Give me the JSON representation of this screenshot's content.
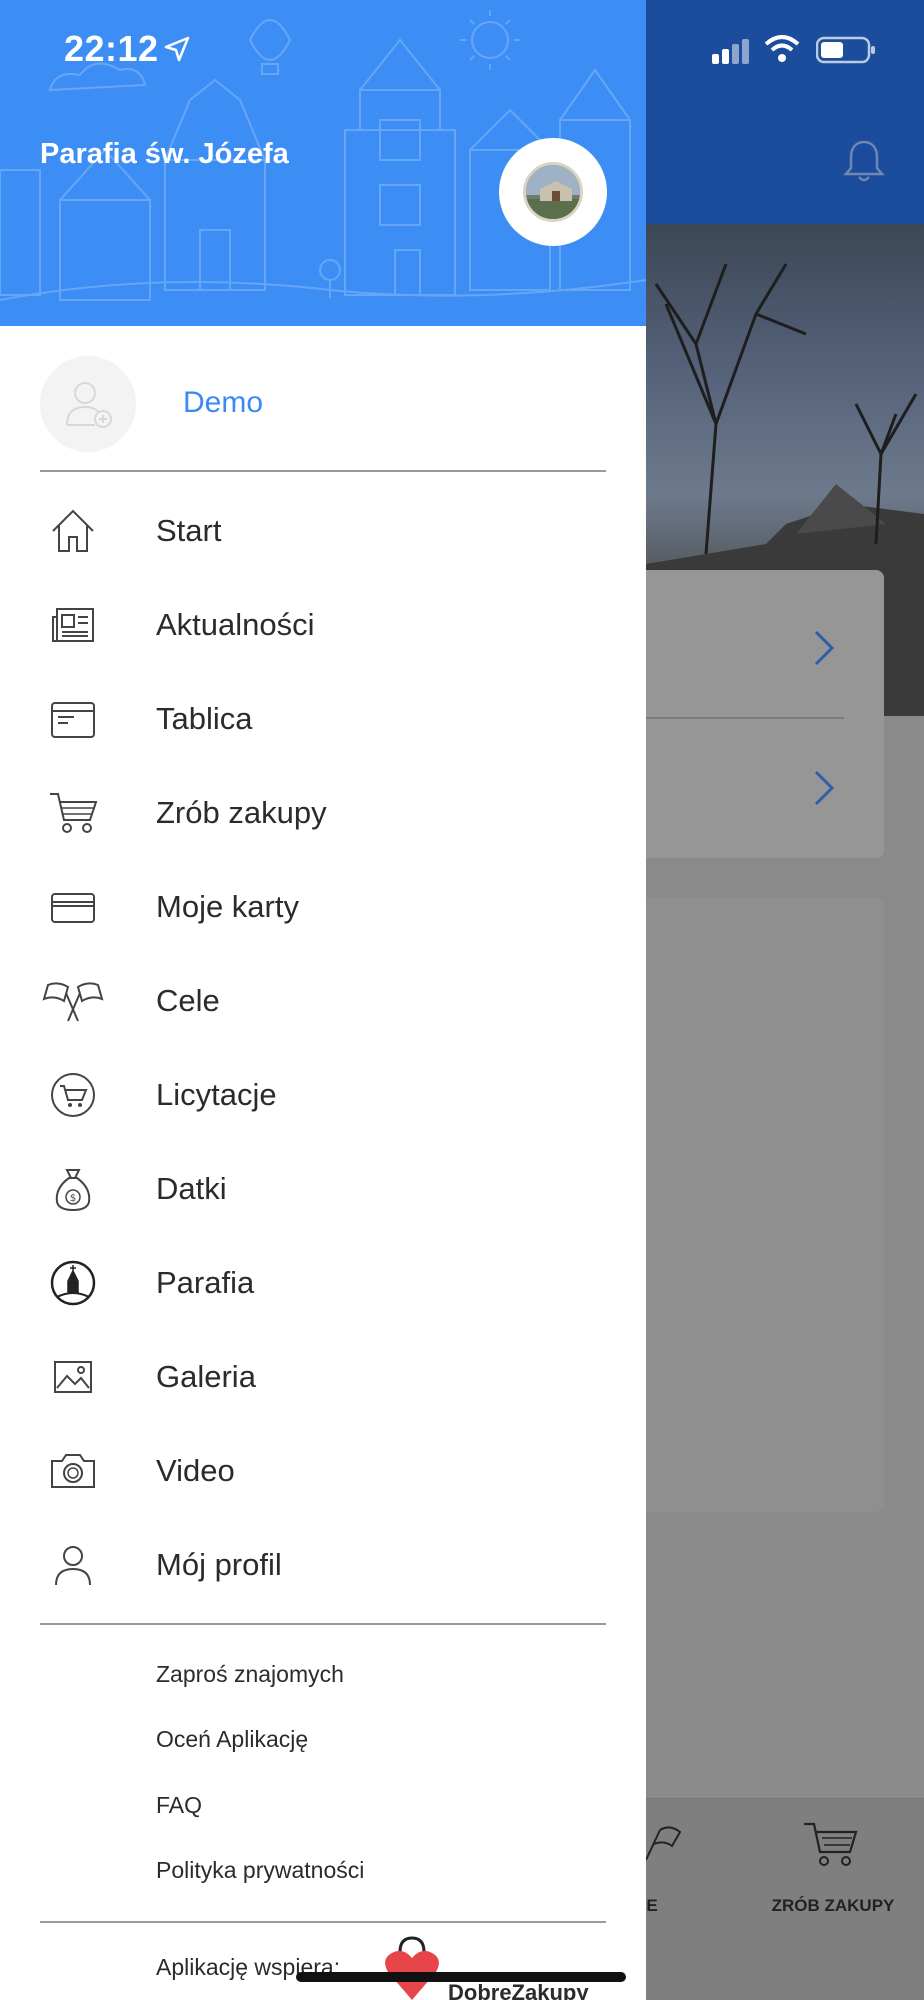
{
  "status_bar": {
    "time": "22:12"
  },
  "drawer": {
    "parish_name": "Parafia św. Józefa",
    "user_name": "Demo",
    "menu": [
      {
        "label": "Start",
        "icon": "home-icon"
      },
      {
        "label": "Aktualności",
        "icon": "newspaper-icon"
      },
      {
        "label": "Tablica",
        "icon": "board-icon"
      },
      {
        "label": "Zrób zakupy",
        "icon": "cart-icon"
      },
      {
        "label": "Moje karty",
        "icon": "card-icon"
      },
      {
        "label": "Cele",
        "icon": "flags-icon"
      },
      {
        "label": "Licytacje",
        "icon": "auction-cart-icon"
      },
      {
        "label": "Datki",
        "icon": "money-bag-icon"
      },
      {
        "label": "Parafia",
        "icon": "church-icon"
      },
      {
        "label": "Galeria",
        "icon": "image-icon"
      },
      {
        "label": "Video",
        "icon": "camera-icon"
      },
      {
        "label": "Mój profil",
        "icon": "profile-icon"
      }
    ],
    "secondary": [
      {
        "label": "Zaproś znajomych"
      },
      {
        "label": "Oceń Aplikację"
      },
      {
        "label": "FAQ"
      },
      {
        "label": "Polityka prywatności"
      }
    ],
    "support_label": "Aplikację wspiera:",
    "support_brand": "DobreZakupy"
  },
  "background": {
    "tab_cele": "LE",
    "tab_shop": "ZRÓB ZAKUPY"
  },
  "colors": {
    "header": "#3d8ef4",
    "accent": "#3b8af2",
    "bg_header": "#1c4c9c"
  }
}
